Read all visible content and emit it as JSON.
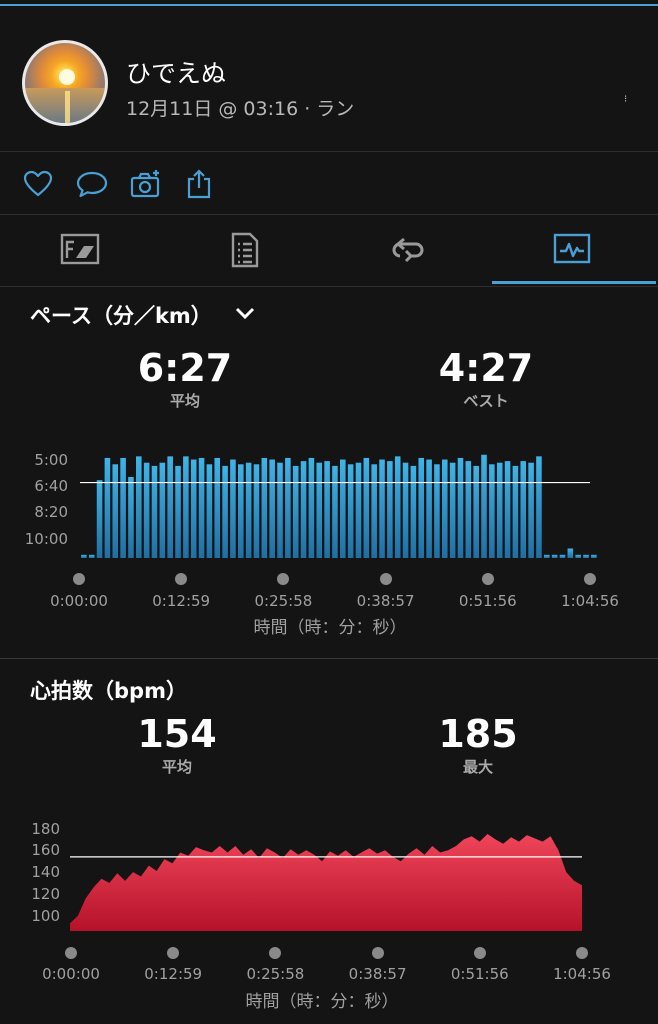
{
  "header": {
    "user_name": "ひでえぬ",
    "activity_meta": "12月11日 @ 03:16 · ラン",
    "more_label": "⁝"
  },
  "icons": {
    "like": "heart-icon",
    "comment": "comment-icon",
    "photo": "camera-add-icon",
    "share": "share-icon",
    "tab_stats": "stats-icon",
    "tab_details": "list-icon",
    "tab_laps": "laps-icon",
    "tab_charts": "chart-icon"
  },
  "colors": {
    "accent": "#4a9fd4",
    "pace": "#3aa6dc",
    "heart_rate": "#e0263c"
  },
  "pace": {
    "title": "ペース（分／km）",
    "avg_value": "6:27",
    "avg_label": "平均",
    "best_value": "4:27",
    "best_label": "ベスト"
  },
  "hr": {
    "title": "心拍数（bpm）",
    "avg_value": "154",
    "avg_label": "平均",
    "max_value": "185",
    "max_label": "最大"
  },
  "chart_data": [
    {
      "type": "area",
      "title": "ペース（分／km）",
      "xlabel": "時間（時：分：秒）",
      "x_ticks": [
        "0:00:00",
        "0:12:59",
        "0:25:58",
        "0:38:57",
        "0:51:56",
        "1:04:56"
      ],
      "y_ticks": [
        "5:00",
        "6:40",
        "8:20",
        "10:00"
      ],
      "y_inverted": true,
      "average": "6:27",
      "average_min": 6.45,
      "ylim_min": [
        4.4,
        11.2
      ],
      "x": [
        0.0,
        1.0,
        2.0,
        3.0,
        4.0,
        5.0,
        6.0,
        7.0,
        8.0,
        9.0,
        10.0,
        11.0,
        12.0,
        13.0,
        14.0,
        15.0,
        16.0,
        17.0,
        18.0,
        19.0,
        20.0,
        21.0,
        22.0,
        23.0,
        24.0,
        25.0,
        26.0,
        27.0,
        28.0,
        29.0,
        30.0,
        31.0,
        32.0,
        33.0,
        34.0,
        35.0,
        36.0,
        37.0,
        38.0,
        39.0,
        40.0,
        41.0,
        42.0,
        43.0,
        44.0,
        45.0,
        46.0,
        47.0,
        48.0,
        49.0,
        50.0,
        51.0,
        52.0,
        53.0,
        54.0,
        55.0,
        56.0,
        57.0,
        58.0,
        59.0,
        60.0,
        61.0,
        62.0,
        63.0,
        64.0,
        65.0
      ],
      "series": [
        {
          "values": [
            11.0,
            11.0,
            6.3,
            4.9,
            5.3,
            4.9,
            6.1,
            4.8,
            5.2,
            5.4,
            5.2,
            4.8,
            5.4,
            4.8,
            5.0,
            4.9,
            5.3,
            4.9,
            5.4,
            5.0,
            5.3,
            5.2,
            5.3,
            4.9,
            5.0,
            5.2,
            4.9,
            5.4,
            5.1,
            4.9,
            5.2,
            5.1,
            5.4,
            5.0,
            5.3,
            5.2,
            4.9,
            5.3,
            5.0,
            5.1,
            4.8,
            5.2,
            5.4,
            4.9,
            5.0,
            5.3,
            5.0,
            5.2,
            4.9,
            5.1,
            5.4,
            4.7,
            5.3,
            5.2,
            5.1,
            5.4,
            5.1,
            5.2,
            4.8,
            11.0,
            11.0,
            11.0,
            10.6,
            11.0,
            11.0,
            11.0
          ]
        }
      ]
    },
    {
      "type": "area",
      "title": "心拍数（bpm）",
      "xlabel": "時間（時：分：秒）",
      "x_ticks": [
        "0:00:00",
        "0:12:59",
        "0:25:58",
        "0:38:57",
        "0:51:56",
        "1:04:56"
      ],
      "y_ticks": [
        "180",
        "160",
        "140",
        "120",
        "100"
      ],
      "average": 154,
      "ylim": [
        86,
        186
      ],
      "x": [
        0.0,
        1.0,
        2.0,
        3.0,
        4.0,
        5.0,
        6.0,
        7.0,
        8.0,
        9.0,
        10.0,
        11.0,
        12.0,
        13.0,
        14.0,
        15.0,
        16.0,
        17.0,
        18.0,
        19.0,
        20.0,
        21.0,
        22.0,
        23.0,
        24.0,
        25.0,
        26.0,
        27.0,
        28.0,
        29.0,
        30.0,
        31.0,
        32.0,
        33.0,
        34.0,
        35.0,
        36.0,
        37.0,
        38.0,
        39.0,
        40.0,
        41.0,
        42.0,
        43.0,
        44.0,
        45.0,
        46.0,
        47.0,
        48.0,
        49.0,
        50.0,
        51.0,
        52.0,
        53.0,
        54.0,
        55.0,
        56.0,
        57.0,
        58.0,
        59.0,
        60.0,
        61.0,
        62.0,
        63.0,
        64.0,
        65.0
      ],
      "series": [
        {
          "values": [
            93,
            100,
            116,
            126,
            134,
            130,
            139,
            132,
            140,
            136,
            146,
            141,
            152,
            148,
            158,
            155,
            163,
            160,
            158,
            164,
            158,
            164,
            156,
            161,
            153,
            162,
            158,
            153,
            161,
            156,
            160,
            156,
            150,
            159,
            155,
            160,
            154,
            158,
            162,
            157,
            160,
            154,
            150,
            157,
            162,
            156,
            164,
            158,
            160,
            164,
            170,
            173,
            168,
            175,
            170,
            166,
            172,
            168,
            174,
            171,
            168,
            173,
            160,
            140,
            132,
            128
          ]
        }
      ]
    }
  ]
}
